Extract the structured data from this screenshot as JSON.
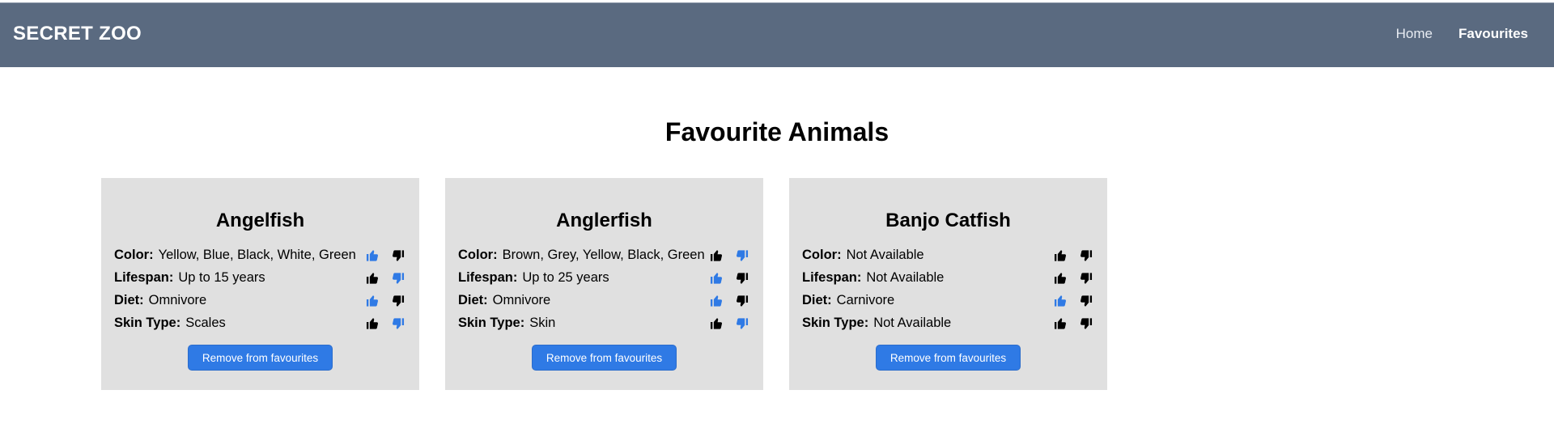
{
  "navbar": {
    "brand": "SECRET ZOO",
    "links": [
      {
        "label": "Home",
        "active": false
      },
      {
        "label": "Favourites",
        "active": true
      }
    ]
  },
  "page": {
    "title": "Favourite Animals"
  },
  "colors": {
    "navbar": "#5a6a80",
    "accent": "#2f7ae5",
    "card": "#e0e0e0"
  },
  "cards": [
    {
      "name": "Angelfish",
      "rows": [
        {
          "label": "Color:",
          "value": "Yellow, Blue, Black, White, Green",
          "up_active": true,
          "down_active": false
        },
        {
          "label": "Lifespan:",
          "value": "Up to 15 years",
          "up_active": false,
          "down_active": true
        },
        {
          "label": "Diet:",
          "value": "Omnivore",
          "up_active": true,
          "down_active": false
        },
        {
          "label": "Skin Type:",
          "value": "Scales",
          "up_active": false,
          "down_active": true
        }
      ],
      "button": "Remove from favourites"
    },
    {
      "name": "Anglerfish",
      "rows": [
        {
          "label": "Color:",
          "value": "Brown, Grey, Yellow, Black, Green",
          "up_active": false,
          "down_active": true
        },
        {
          "label": "Lifespan:",
          "value": "Up to 25 years",
          "up_active": true,
          "down_active": false
        },
        {
          "label": "Diet:",
          "value": "Omnivore",
          "up_active": true,
          "down_active": false
        },
        {
          "label": "Skin Type:",
          "value": "Skin",
          "up_active": false,
          "down_active": true
        }
      ],
      "button": "Remove from favourites"
    },
    {
      "name": "Banjo Catfish",
      "rows": [
        {
          "label": "Color:",
          "value": "Not Available",
          "up_active": false,
          "down_active": false
        },
        {
          "label": "Lifespan:",
          "value": "Not Available",
          "up_active": false,
          "down_active": false
        },
        {
          "label": "Diet:",
          "value": "Carnivore",
          "up_active": true,
          "down_active": false
        },
        {
          "label": "Skin Type:",
          "value": "Not Available",
          "up_active": false,
          "down_active": false
        }
      ],
      "button": "Remove from favourites"
    }
  ]
}
